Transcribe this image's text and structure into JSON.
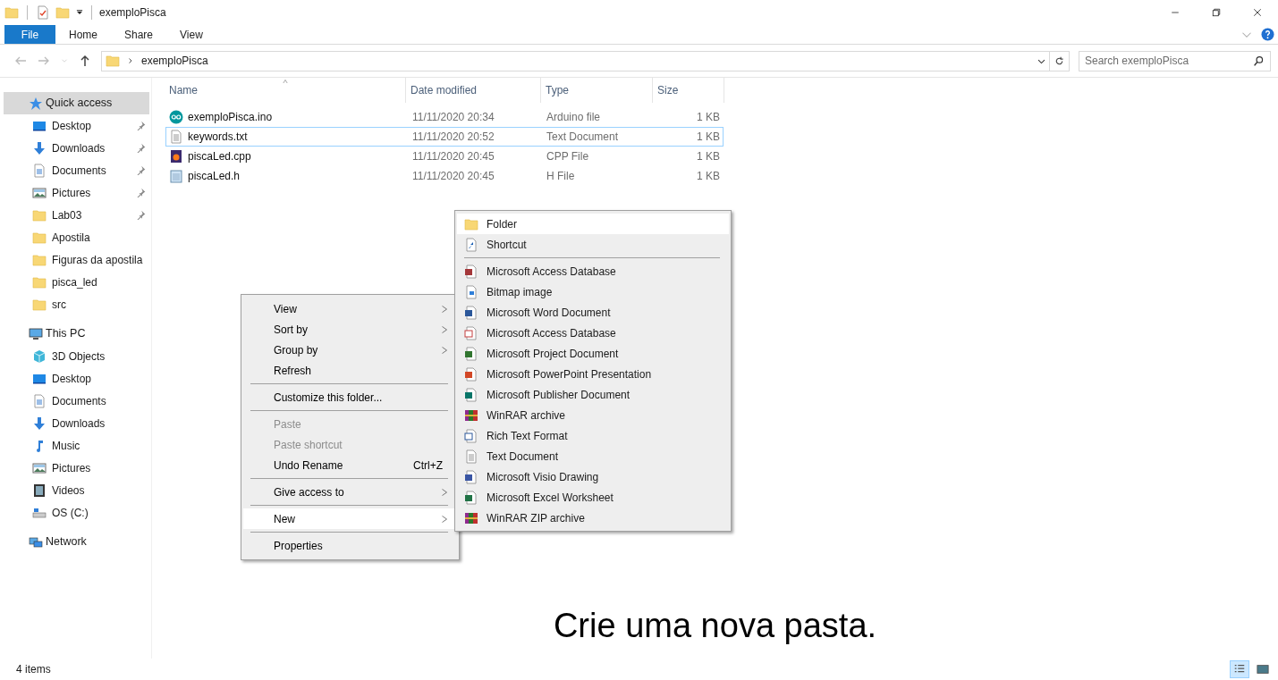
{
  "window": {
    "title": "exemploPisca"
  },
  "ribbon": {
    "tabs": [
      {
        "label": "File",
        "kind": "file"
      },
      {
        "label": "Home",
        "kind": "tab"
      },
      {
        "label": "Share",
        "kind": "tab"
      },
      {
        "label": "View",
        "kind": "tab"
      }
    ]
  },
  "address_bar": {
    "path": "exemploPisca",
    "search_placeholder": "Search exemploPisca"
  },
  "sidebar": {
    "items": [
      {
        "label": "Quick access",
        "kind": "star",
        "selected": true,
        "children": [
          {
            "label": "Desktop",
            "kind": "desktop",
            "pinned": true,
            "selected": false
          },
          {
            "label": "Downloads",
            "kind": "download",
            "pinned": true,
            "selected": false
          },
          {
            "label": "Documents",
            "kind": "document",
            "pinned": true,
            "selected": false
          },
          {
            "label": "Pictures",
            "kind": "picture",
            "pinned": true,
            "selected": false
          },
          {
            "label": "Lab03",
            "kind": "folder",
            "pinned": true,
            "selected": false
          },
          {
            "label": "Apostila",
            "kind": "folder",
            "pinned": false,
            "selected": false
          },
          {
            "label": "Figuras da apostila",
            "kind": "folder",
            "pinned": false,
            "selected": false
          },
          {
            "label": "pisca_led",
            "kind": "folder",
            "pinned": false,
            "selected": false
          },
          {
            "label": "src",
            "kind": "folder",
            "pinned": false,
            "selected": false
          }
        ]
      },
      {
        "label": "This PC",
        "kind": "pc",
        "selected": false,
        "children": [
          {
            "label": "3D Objects",
            "kind": "cube",
            "pinned": false,
            "selected": false
          },
          {
            "label": "Desktop",
            "kind": "desktop",
            "pinned": false,
            "selected": false
          },
          {
            "label": "Documents",
            "kind": "document",
            "pinned": false,
            "selected": false
          },
          {
            "label": "Downloads",
            "kind": "download",
            "pinned": false,
            "selected": false
          },
          {
            "label": "Music",
            "kind": "music",
            "pinned": false,
            "selected": false
          },
          {
            "label": "Pictures",
            "kind": "picture",
            "pinned": false,
            "selected": false
          },
          {
            "label": "Videos",
            "kind": "video",
            "pinned": false,
            "selected": false
          },
          {
            "label": "OS (C:)",
            "kind": "drive",
            "pinned": false,
            "selected": false
          }
        ]
      },
      {
        "label": "Network",
        "kind": "network",
        "selected": false
      }
    ]
  },
  "file_list": {
    "columns": [
      "Name",
      "Date modified",
      "Type",
      "Size"
    ],
    "rows": [
      {
        "name": "exemploPisca.ino",
        "date": "11/11/2020 20:34",
        "type": "Arduino file",
        "size": "1 KB",
        "kind": "arduino",
        "selected": false
      },
      {
        "name": "keywords.txt",
        "date": "11/11/2020 20:52",
        "type": "Text Document",
        "size": "1 KB",
        "kind": "text",
        "selected": true
      },
      {
        "name": "piscaLed.cpp",
        "date": "11/11/2020 20:45",
        "type": "CPP File",
        "size": "1 KB",
        "kind": "cpp",
        "selected": false
      },
      {
        "name": "piscaLed.h",
        "date": "11/11/2020 20:45",
        "type": "H File",
        "size": "1 KB",
        "kind": "header",
        "selected": false
      }
    ]
  },
  "context_menu": {
    "items": [
      {
        "kind": "item",
        "label": "View",
        "submenu": true,
        "disabled": false,
        "selected": false
      },
      {
        "kind": "item",
        "label": "Sort by",
        "submenu": true,
        "disabled": false,
        "selected": false
      },
      {
        "kind": "item",
        "label": "Group by",
        "submenu": true,
        "disabled": false,
        "selected": false
      },
      {
        "kind": "item",
        "label": "Refresh",
        "submenu": false,
        "disabled": false,
        "selected": false
      },
      {
        "kind": "separator"
      },
      {
        "kind": "item",
        "label": "Customize this folder...",
        "submenu": false,
        "disabled": false,
        "selected": false
      },
      {
        "kind": "separator"
      },
      {
        "kind": "item",
        "label": "Paste",
        "submenu": false,
        "disabled": true,
        "selected": false
      },
      {
        "kind": "item",
        "label": "Paste shortcut",
        "submenu": false,
        "disabled": true,
        "selected": false
      },
      {
        "kind": "item",
        "label": "Undo Rename",
        "shortcut": "Ctrl+Z",
        "submenu": false,
        "disabled": false,
        "selected": false
      },
      {
        "kind": "separator"
      },
      {
        "kind": "item",
        "label": "Give access to",
        "submenu": true,
        "disabled": false,
        "selected": false
      },
      {
        "kind": "separator"
      },
      {
        "kind": "item",
        "label": "New",
        "submenu": true,
        "disabled": false,
        "selected": true
      },
      {
        "kind": "separator"
      },
      {
        "kind": "item",
        "label": "Properties",
        "submenu": false,
        "disabled": false,
        "selected": false
      }
    ]
  },
  "new_submenu": {
    "items": [
      {
        "kind": "folder",
        "label": "Folder",
        "selected": true
      },
      {
        "kind": "shortcut",
        "label": "Shortcut",
        "selected": false
      },
      {
        "kind": "separator"
      },
      {
        "kind": "access",
        "label": "Microsoft Access Database",
        "selected": false
      },
      {
        "kind": "bitmap",
        "label": "Bitmap image",
        "selected": false
      },
      {
        "kind": "word",
        "label": "Microsoft Word Document",
        "selected": false
      },
      {
        "kind": "access2",
        "label": "Microsoft Access Database",
        "selected": false
      },
      {
        "kind": "project",
        "label": "Microsoft Project Document",
        "selected": false
      },
      {
        "kind": "powerpoint",
        "label": "Microsoft PowerPoint Presentation",
        "selected": false
      },
      {
        "kind": "publisher",
        "label": "Microsoft Publisher Document",
        "selected": false
      },
      {
        "kind": "winrar",
        "label": "WinRAR archive",
        "selected": false
      },
      {
        "kind": "rtf",
        "label": "Rich Text Format",
        "selected": false
      },
      {
        "kind": "text",
        "label": "Text Document",
        "selected": false
      },
      {
        "kind": "visio",
        "label": "Microsoft Visio Drawing",
        "selected": false
      },
      {
        "kind": "excel",
        "label": "Microsoft Excel Worksheet",
        "selected": false
      },
      {
        "kind": "winrar",
        "label": "WinRAR ZIP archive",
        "selected": false
      }
    ]
  },
  "caption": "Crie uma nova pasta.",
  "status_bar": {
    "item_count": "4 items",
    "views": [
      {
        "kind": "details",
        "selected": true
      },
      {
        "kind": "large",
        "selected": false
      }
    ]
  }
}
